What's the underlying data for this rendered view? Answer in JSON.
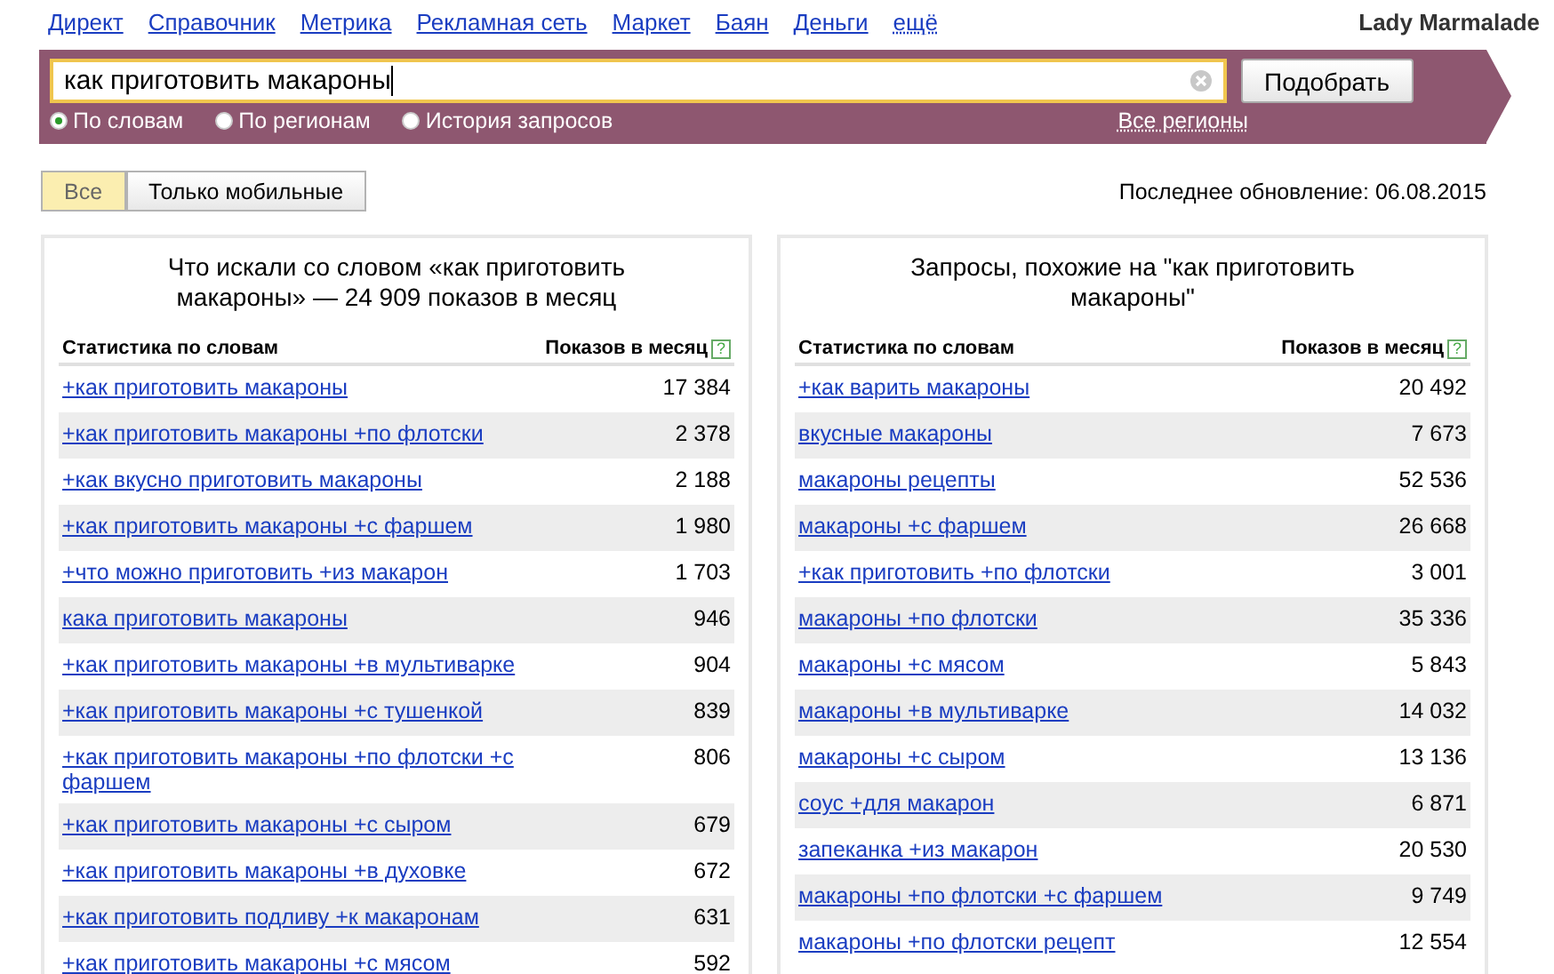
{
  "nav": {
    "links": [
      "Директ",
      "Справочник",
      "Метрика",
      "Рекламная сеть",
      "Маркет",
      "Баян",
      "Деньги"
    ],
    "more": "ещё"
  },
  "user": "Lady Marmalade",
  "search": {
    "value": "как приготовить макароны",
    "button": "Подобрать",
    "modes": [
      {
        "label": "По словам",
        "selected": true
      },
      {
        "label": "По регионам",
        "selected": false
      },
      {
        "label": "История запросов",
        "selected": false
      }
    ],
    "regions": "Все регионы"
  },
  "filters": [
    {
      "label": "Все",
      "selected": true
    },
    {
      "label": "Только мобильные",
      "selected": false
    }
  ],
  "last_update": "Последнее обновление: 06.08.2015",
  "panels": [
    {
      "title": "Что искали со словом «как приготовить макароны» — 24 909 показов в месяц",
      "columns": [
        "Статистика по словам",
        "Показов в месяц"
      ],
      "help": "?",
      "rows": [
        {
          "phrase": "+как приготовить макароны",
          "count": "17 384"
        },
        {
          "phrase": "+как приготовить макароны +по флотски",
          "count": "2 378"
        },
        {
          "phrase": "+как вкусно приготовить макароны",
          "count": "2 188"
        },
        {
          "phrase": "+как приготовить макароны +с фаршем",
          "count": "1 980"
        },
        {
          "phrase": "+что можно приготовить +из макарон",
          "count": "1 703"
        },
        {
          "phrase": "кака приготовить макароны",
          "count": "946"
        },
        {
          "phrase": "+как приготовить макароны +в мультиварке",
          "count": "904"
        },
        {
          "phrase": "+как приготовить макароны +с тушенкой",
          "count": "839"
        },
        {
          "phrase": "+как приготовить макароны +по флотски +с фаршем",
          "count": "806"
        },
        {
          "phrase": "+как приготовить макароны +с сыром",
          "count": "679"
        },
        {
          "phrase": "+как приготовить макароны +в духовке",
          "count": "672"
        },
        {
          "phrase": "+как приготовить подливу +к макаронам",
          "count": "631"
        },
        {
          "phrase": "+как приготовить макароны +с мясом",
          "count": "592"
        }
      ]
    },
    {
      "title": "Запросы, похожие на \"как приготовить макароны\"",
      "columns": [
        "Статистика по словам",
        "Показов в месяц"
      ],
      "help": "?",
      "rows": [
        {
          "phrase": "+как варить макароны",
          "count": "20 492"
        },
        {
          "phrase": "вкусные макароны",
          "count": "7 673"
        },
        {
          "phrase": "макароны рецепты",
          "count": "52 536"
        },
        {
          "phrase": "макароны +с фаршем",
          "count": "26 668"
        },
        {
          "phrase": "+как приготовить +по флотски",
          "count": "3 001"
        },
        {
          "phrase": "макароны +по флотски",
          "count": "35 336"
        },
        {
          "phrase": "макароны +с мясом",
          "count": "5 843"
        },
        {
          "phrase": "макароны +в мультиварке",
          "count": "14 032"
        },
        {
          "phrase": "макароны +с сыром",
          "count": "13 136"
        },
        {
          "phrase": "соус +для макарон",
          "count": "6 871"
        },
        {
          "phrase": "запеканка +из макарон",
          "count": "20 530"
        },
        {
          "phrase": "макароны +по флотски +с фаршем",
          "count": "9 749"
        },
        {
          "phrase": "макароны +по флотски рецепт",
          "count": "12 554"
        }
      ]
    }
  ]
}
